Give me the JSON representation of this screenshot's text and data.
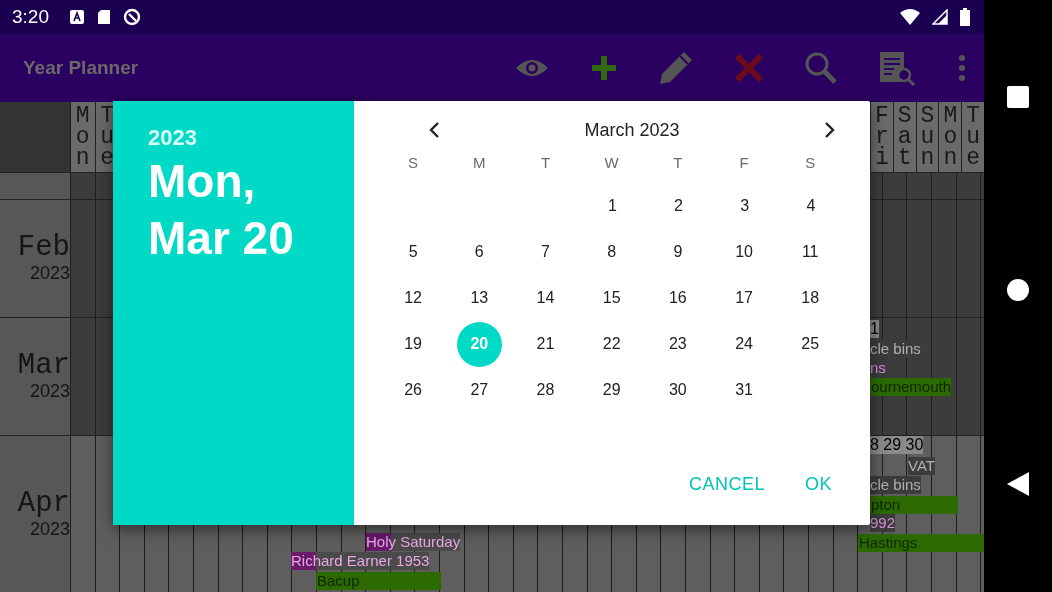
{
  "status_bar": {
    "time": "3:20"
  },
  "app_bar": {
    "title": "Year Planner"
  },
  "planner": {
    "left_day_headers": [
      "Mon",
      "Tue"
    ],
    "right_day_headers": [
      "Fri",
      "Sat",
      "Sun",
      "Mon",
      "Tue"
    ],
    "months": [
      {
        "month": "Feb",
        "year": "2023"
      },
      {
        "month": "Mar",
        "year": "2023",
        "events": [
          {
            "kind": "text",
            "text": "1"
          },
          {
            "kind": "faded",
            "text": "cle bins"
          },
          {
            "kind": "purple",
            "text": "ns"
          },
          {
            "kind": "bar",
            "text": "ournemouth"
          }
        ]
      },
      {
        "month": "Apr",
        "year": "2023",
        "events": [
          {
            "kind": "text",
            "text": "8 29 30"
          },
          {
            "kind": "faded",
            "text": "VAT"
          },
          {
            "kind": "faded",
            "text": "cle bins"
          },
          {
            "kind": "bar",
            "text": "pton"
          },
          {
            "kind": "purple",
            "text": "992"
          },
          {
            "kind": "tagged",
            "text": "Holy Saturday"
          },
          {
            "kind": "bar",
            "text": "Hastings"
          },
          {
            "kind": "tagged",
            "text": "Richard Earner 1953"
          },
          {
            "kind": "bar",
            "text": "Bacup"
          }
        ]
      }
    ]
  },
  "dialog": {
    "year": "2023",
    "date": "Mon, Mar 20",
    "month_title": "March 2023",
    "weekdays": [
      "S",
      "M",
      "T",
      "W",
      "T",
      "F",
      "S"
    ],
    "weeks": [
      [
        {
          "day": "1",
          "selected": false
        },
        {
          "day": "2",
          "selected": false
        },
        {
          "day": "3",
          "selected": false
        },
        {
          "day": "4",
          "selected": false
        }
      ],
      [
        {
          "day": "5",
          "selected": false
        },
        {
          "day": "6",
          "selected": false
        },
        {
          "day": "7",
          "selected": false
        },
        {
          "day": "8",
          "selected": false
        },
        {
          "day": "9",
          "selected": false
        },
        {
          "day": "10",
          "selected": false
        },
        {
          "day": "11",
          "selected": false
        }
      ],
      [
        {
          "day": "12",
          "selected": false
        },
        {
          "day": "13",
          "selected": false
        },
        {
          "day": "14",
          "selected": false
        },
        {
          "day": "15",
          "selected": false
        },
        {
          "day": "16",
          "selected": false
        },
        {
          "day": "17",
          "selected": false
        },
        {
          "day": "18",
          "selected": false
        }
      ],
      [
        {
          "day": "19",
          "selected": false
        },
        {
          "day": "20",
          "selected": true
        },
        {
          "day": "21",
          "selected": false
        },
        {
          "day": "22",
          "selected": false
        },
        {
          "day": "23",
          "selected": false
        },
        {
          "day": "24",
          "selected": false
        },
        {
          "day": "25",
          "selected": false
        }
      ],
      [
        {
          "day": "26",
          "selected": false
        },
        {
          "day": "27",
          "selected": false
        },
        {
          "day": "28",
          "selected": false
        },
        {
          "day": "29",
          "selected": false
        },
        {
          "day": "30",
          "selected": false
        },
        {
          "day": "31",
          "selected": false
        }
      ]
    ],
    "buttons": [
      "CANCEL",
      "OK"
    ]
  }
}
